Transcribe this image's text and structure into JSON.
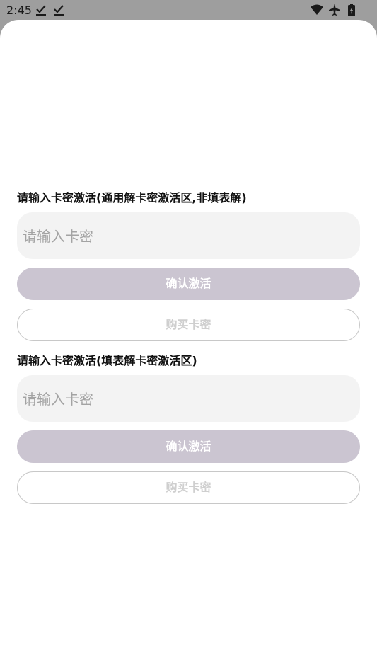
{
  "status_bar": {
    "time": "2:45",
    "icons": [
      "download-done-icon",
      "download-done-icon",
      "wifi-icon",
      "airplane-icon",
      "battery-icon"
    ]
  },
  "sections": [
    {
      "title": "请输入卡密激活(通用解卡密激活区,非填表解)",
      "input_placeholder": "请输入卡密",
      "input_value": "",
      "confirm_label": "确认激活",
      "buy_label": "购买卡密"
    },
    {
      "title": "请输入卡密激活(填表解卡密激活区)",
      "input_placeholder": "请输入卡密",
      "input_value": "",
      "confirm_label": "确认激活",
      "buy_label": "购买卡密"
    }
  ],
  "colors": {
    "status_bar_bg": "#9e9e9e",
    "input_bg": "#f3f3f3",
    "confirm_button_bg": "#cbc5d1",
    "outline_border": "#c8c8c8"
  }
}
